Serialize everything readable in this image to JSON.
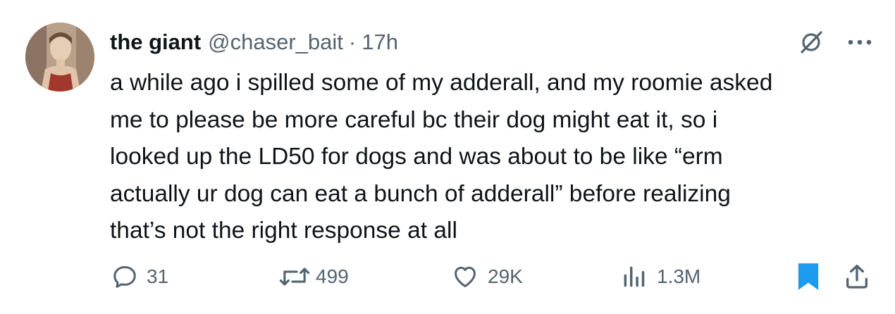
{
  "author": {
    "name": "the giant",
    "handle": "@chaser_bait",
    "separator": "·",
    "time": "17h"
  },
  "tweet": {
    "lines": [
      "a while ago i spilled some of my adderall, and my roomie asked",
      "me to please be more careful bc their dog might eat it, so i",
      "looked up the LD50 for dogs and was about to be like “erm",
      "actually ur dog can eat a bunch of adderall” before realizing",
      "that’s not the right response at all"
    ]
  },
  "actions": {
    "replies": "31",
    "reposts": "499",
    "likes": "29K",
    "views": "1.3M"
  },
  "icons": {
    "top_right": [
      "grok-icon",
      "more-icon"
    ],
    "action_bar": [
      "reply-icon",
      "repost-icon",
      "like-icon",
      "views-icon",
      "bookmark-icon",
      "share-icon"
    ]
  },
  "colors": {
    "text": "#0f1419",
    "secondary": "#536471",
    "bookmark_active": "#1d9bf0"
  }
}
